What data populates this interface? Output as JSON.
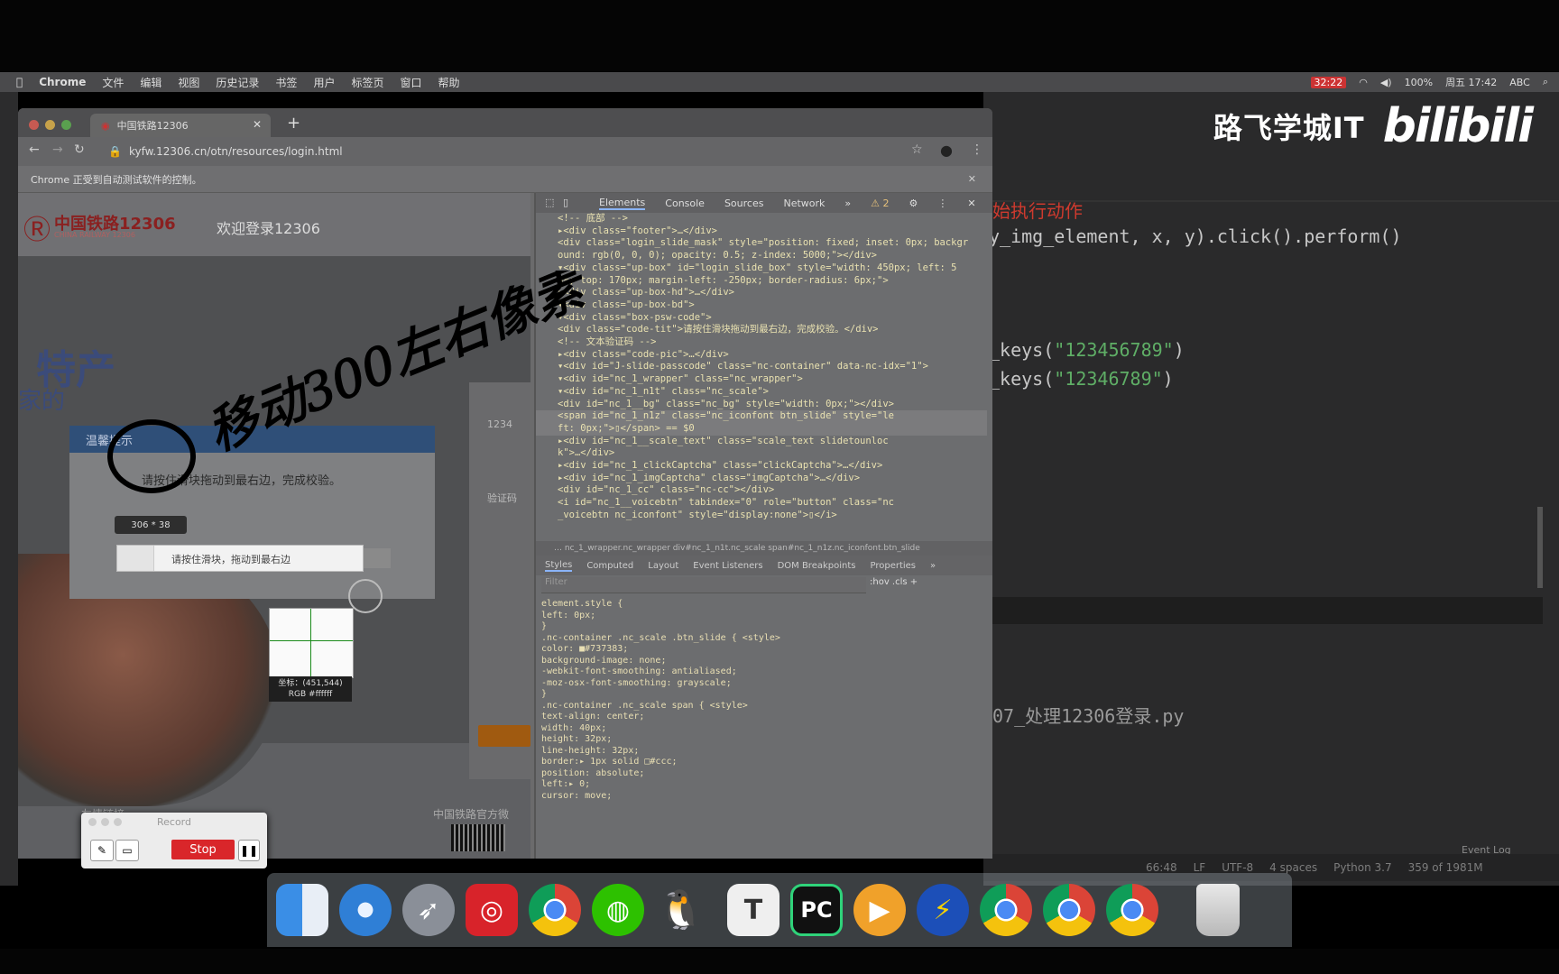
{
  "menubar": {
    "apple": "",
    "items": [
      "Chrome",
      "文件",
      "编辑",
      "视图",
      "历史记录",
      "书签",
      "用户",
      "标签页",
      "窗口",
      "帮助"
    ],
    "rec_time": "32:22",
    "battery": "100%",
    "clock": "周五 17:42",
    "input": "ABC"
  },
  "watermark": {
    "lufei": "路飞学城IT",
    "bilibili": "bilibili"
  },
  "ide": {
    "comment_line": "始执行动作",
    "code_line1": "y_img_element, x, y).click().perform()",
    "keys1_prefix": "_keys(",
    "keys1_value": "\"123456789\"",
    "keys2_prefix": "_keys(",
    "keys2_value": "\"12346789\"",
    "suffix": ")",
    "bottom_file": "07_处理12306登录.py",
    "status": {
      "pos": "66:48",
      "lf": "LF",
      "enc": "UTF-8",
      "indent": "4 spaces",
      "py": "Python 3.7",
      "mem": "359 of 1981M"
    },
    "event_log": "Event Log",
    "tab_label": "07_"
  },
  "browser": {
    "tab_title": "中国铁路12306",
    "url": "kyfw.12306.cn/otn/resources/login.html",
    "infobar": "Chrome 正受到自动测试软件的控制。"
  },
  "page": {
    "brand": "中国铁路12306",
    "brand_sub": "CHINA RAILWAY 12306",
    "welcome": "欢迎登录12306",
    "hero_text": "特产",
    "hero_text2": "家的",
    "footer_left": "友情链接",
    "footer_right": "中国铁路官方微",
    "login_field1": "1234",
    "login_field3": "验证码"
  },
  "dialog": {
    "title": "温馨提示",
    "message": "请按住滑块拖动到最右边，完成校验。",
    "size_tip": "306 * 38",
    "slider_text": "请按住滑块，拖动到最右边"
  },
  "magnifier": {
    "coords": "坐标：(451,544)",
    "rgb": "RGB #ffffff"
  },
  "devtools": {
    "tabs": [
      "Elements",
      "Console",
      "Sources",
      "Network",
      "»"
    ],
    "warnings": "⚠ 2",
    "tree": [
      "<!-- 底部 -->",
      "▸<div class=\"footer\">…</div>",
      " <div class=\"login_slide_mask\" style=\"position: fixed; inset: 0px; backgr",
      " ound: rgb(0, 0, 0); opacity: 0.5; z-index: 5000;\"></div>",
      "▾<div class=\"up-box\" id=\"login_slide_box\" style=\"width: 450px; left: 5",
      " 0%; top: 170px; margin-left: -250px; border-radius: 6px;\">",
      "  ▸<div class=\"up-box-hd\">…</div>",
      "  ▾<div class=\"up-box-bd\">",
      "    ▾<div class=\"box-psw-code\">",
      "       <div class=\"code-tit\">请按住滑块拖动到最右边，完成校验。</div>",
      "       <!-- 文本验证码 -->",
      "      ▸<div class=\"code-pic\">…</div>",
      "      ▾<div id=\"J-slide-passcode\" class=\"nc-container\" data-nc-idx=\"1\">",
      "        ▾<div id=\"nc_1_wrapper\" class=\"nc_wrapper\">",
      "          ▾<div id=\"nc_1_n1t\" class=\"nc_scale\">",
      "             <div id=\"nc_1__bg\" class=\"nc_bg\" style=\"width: 0px;\"></div>",
      "             <span id=\"nc_1_n1z\" class=\"nc_iconfont btn_slide\" style=\"le",
      "             ft: 0px;\">▯</span> == $0",
      "            ▸<div id=\"nc_1__scale_text\" class=\"scale_text slidetounloc",
      "            k\">…</div>",
      "            ▸<div id=\"nc_1_clickCaptcha\" class=\"clickCaptcha\">…</div>",
      "            ▸<div id=\"nc_1_imgCaptcha\" class=\"imgCaptcha\">…</div>",
      "             <div id=\"nc_1_cc\" class=\"nc-cc\"></div>",
      "             <i id=\"nc_1__voicebtn\" tabindex=\"0\" role=\"button\" class=\"nc",
      "             _voicebtn nc_iconfont\" style=\"display:none\">▯</i>"
    ],
    "crumbs": "… nc_1_wrapper.nc_wrapper   div#nc_1_n1t.nc_scale   span#nc_1_n1z.nc_iconfont.btn_slide",
    "subtabs": [
      "Styles",
      "Computed",
      "Layout",
      "Event Listeners",
      "DOM Breakpoints",
      "Properties",
      "»"
    ],
    "filter_placeholder": "Filter",
    "filter_right": ":hov  .cls  +",
    "styles": [
      "element.style {",
      "  left: 0px;",
      "}",
      ".nc-container .nc_scale .btn_slide {                              <style>",
      "  color: ■#737383;",
      "  background-image: none;",
      "  -webkit-font-smoothing: antialiased;",
      "  -moz-osx-font-smoothing: grayscale;",
      "}",
      ".nc-container .nc_scale span {                                    <style>",
      "  text-align: center;",
      "  width: 40px;",
      "  height: 32px;",
      "  line-height: 32px;",
      "  border:▸ 1px solid □#ccc;",
      "  position: absolute;",
      "  left:▸ 0;",
      "  cursor: move;"
    ]
  },
  "annotation": {
    "text": "移动300左右像素"
  },
  "record": {
    "title": "Record",
    "stop": "Stop"
  },
  "dock": {
    "apps": [
      "finder-icon",
      "safari-icon",
      "launchpad-icon",
      "netease-music-icon",
      "chrome-icon",
      "wechat-icon",
      "qq-icon",
      "typora-icon",
      "pycharm-icon",
      "player-icon",
      "thunder-icon",
      "chrome-icon",
      "chrome-icon",
      "chrome-icon",
      "trash-icon"
    ]
  }
}
